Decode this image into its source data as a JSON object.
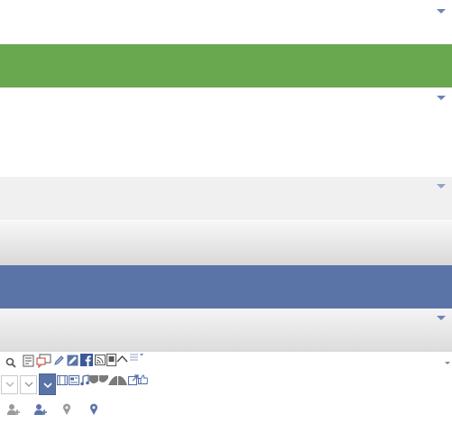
{
  "colors": {
    "green_band": "#6aa84f",
    "blue_band": "#5b74a8",
    "gray_band": "#f0f0f0",
    "caret": "#6d84b4",
    "icon_gray": "#7a7a7a",
    "icon_blue": "#4e6aa5"
  },
  "bands": [
    {
      "name": "white-band-1",
      "style": "white",
      "has_caret": true
    },
    {
      "name": "green-band",
      "style": "green",
      "has_caret": false
    },
    {
      "name": "white-band-2",
      "style": "white",
      "has_caret": true
    },
    {
      "name": "light-gray-band",
      "style": "gray",
      "has_caret": true
    },
    {
      "name": "gradient-gray-band",
      "style": "gradient",
      "has_caret": false
    },
    {
      "name": "blue-band",
      "style": "blue",
      "has_caret": false
    },
    {
      "name": "gradient-gray-band-2",
      "style": "gradient",
      "has_caret": true
    }
  ],
  "toolbar_row_1_icons": [
    "search-icon",
    "note-icon",
    "comment-icon",
    "pencil-icon",
    "edit-icon",
    "facebook-icon",
    "rss-icon",
    "mobile-icon",
    "chevron-up-icon",
    "list-dropdown-icon"
  ],
  "toolbar_row_2_buttons": [
    "dropdown-button-1",
    "dropdown-button-2",
    "dropdown-button-active"
  ],
  "toolbar_row_2_icons": [
    "film-icon",
    "newspaper-icon",
    "music-icon",
    "shape-left-icon",
    "shape-right-icon",
    "external-link-icon",
    "thumbs-up-icon"
  ],
  "toolbar_row_3_icons": [
    "add-friend-gray-icon",
    "add-friend-blue-icon",
    "location-pin-gray-icon",
    "location-pin-blue-icon"
  ]
}
